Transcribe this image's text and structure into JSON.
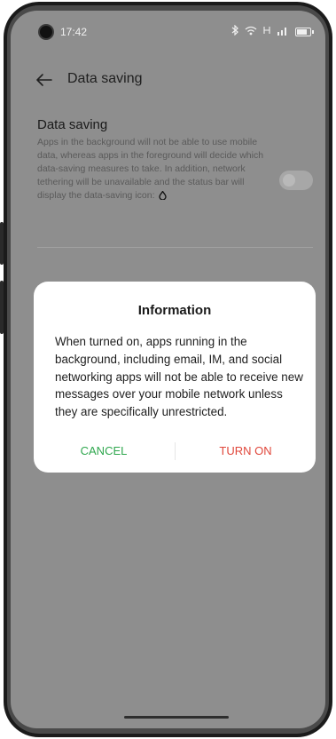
{
  "status_bar": {
    "time": "17:42",
    "icons": [
      "bluetooth-icon",
      "wifi-icon",
      "hd-icon",
      "signal-icon",
      "battery-icon"
    ]
  },
  "toolbar": {
    "title": "Data saving"
  },
  "setting": {
    "title": "Data saving",
    "description": "Apps in the background will not be able to use mobile data, whereas apps in the foreground will decide which data-saving measures to take. In addition, network tethering will be unavailable and the status bar will display the data-saving icon:",
    "toggle_on": false
  },
  "dialog": {
    "title": "Information",
    "body": "When turned on, apps running in the background, including email, IM, and social networking apps will not be able to receive new messages over your mobile network unless they are specifically unrestricted.",
    "cancel_label": "CANCEL",
    "confirm_label": "TURN ON"
  },
  "colors": {
    "cancel": "#2fa74e",
    "confirm": "#e0473b",
    "scrim": "#8e8e8e"
  }
}
